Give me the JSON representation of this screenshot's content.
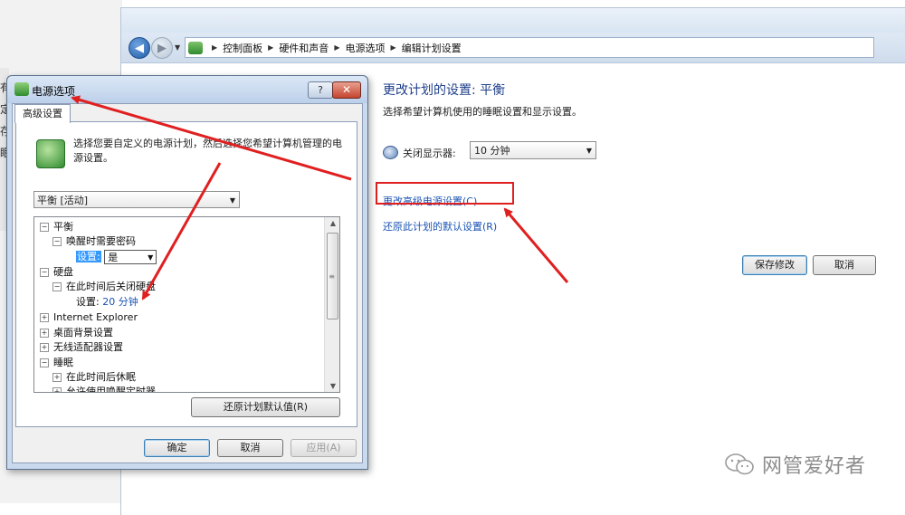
{
  "background": {
    "left_chars": [
      "有",
      "定",
      "存",
      "",
      "眠"
    ]
  },
  "control_panel": {
    "breadcrumb": [
      "控制面板",
      "硬件和声音",
      "电源选项",
      "编辑计划设置"
    ],
    "heading": "更改计划的设置: 平衡",
    "description": "选择希望计算机使用的睡眠设置和显示设置。",
    "display_off_label": "关闭显示器:",
    "display_off_value": "10 分钟",
    "advanced_link": "更改高级电源设置(C)",
    "restore_link": "还原此计划的默认设置(R)",
    "save_button": "保存修改",
    "cancel_button": "取消"
  },
  "dialog": {
    "title": "电源选项",
    "help_button": "?",
    "close_button": "✕",
    "tab": "高级设置",
    "intro": "选择您要自定义的电源计划，然后选择您希望计算机管理的电源设置。",
    "plan_select": "平衡 [活动]",
    "tree": {
      "balance": "平衡",
      "wake_password": "唤醒时需要密码",
      "setting_label": "设置:",
      "setting_value": "是",
      "hard_disk": "硬盘",
      "hdd_off_after": "在此时间后关闭硬盘",
      "hdd_setting_label": "设置:",
      "hdd_setting_value": "20 分钟",
      "ie": "Internet Explorer",
      "desktop_bg": "桌面背景设置",
      "wireless": "无线适配器设置",
      "sleep": "睡眠",
      "sleep_after": "在此时间后休眠",
      "allow_wake_timers": "允许使用唤醒定时器"
    },
    "restore_button": "还原计划默认值(R)",
    "ok_button": "确定",
    "cancel_button": "取消",
    "apply_button": "应用(A)"
  },
  "watermark": {
    "text": "网管爱好者"
  },
  "colors": {
    "link": "#1a53b4",
    "heading": "#1e3f8a",
    "annotation": "#e02020",
    "selection": "#3399ff"
  }
}
